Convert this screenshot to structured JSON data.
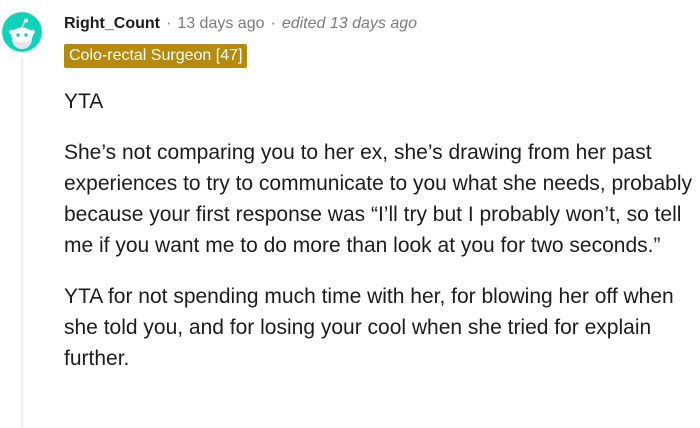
{
  "comment": {
    "username": "Right_Count",
    "separator": "·",
    "timestamp": "13 days ago",
    "edited": "edited 13 days ago",
    "flair": "Colo-rectal Surgeon [47]",
    "avatar_icon": "snoo-avatar-icon",
    "paragraphs": [
      "YTA",
      "She’s not comparing you to her ex, she’s drawing from her past experiences to try to communicate to you what she needs, probably because your first response was “I’ll try but I probably won’t, so tell me if you want me to do more than look at you for two seconds.”",
      "YTA for not spending much time with her, for blowing her off when she told you, and for losing your cool when she tried for explain further."
    ]
  },
  "colors": {
    "avatar_bg": "#0dd3bb",
    "flair_bg": "#b58a0f",
    "meta_text": "#7c7c7c"
  }
}
